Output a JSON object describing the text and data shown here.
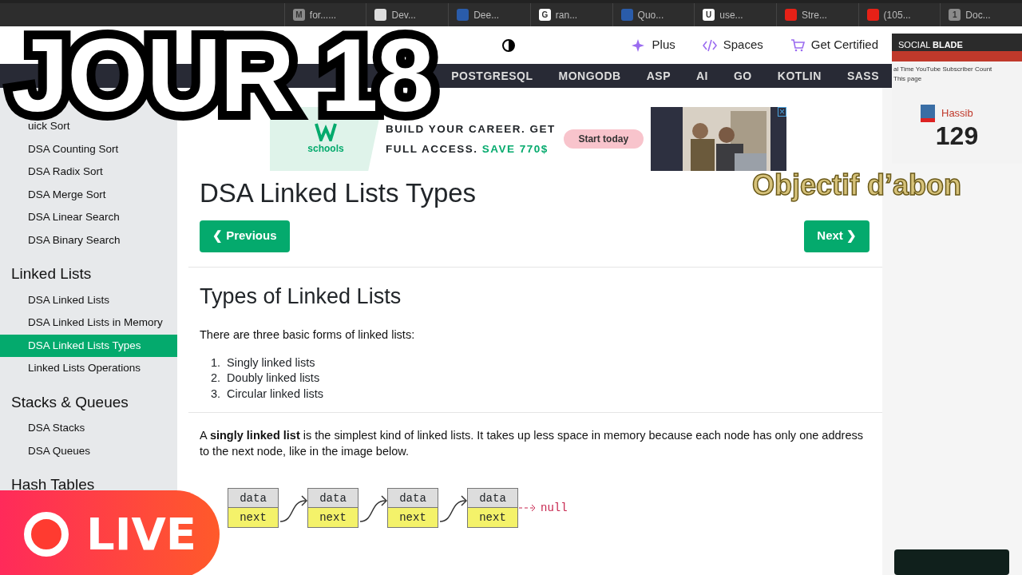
{
  "browser_tabs": [
    {
      "title": "for......",
      "icon": "M",
      "color": "#8a8a8a"
    },
    {
      "title": "Dev...",
      "color": "#dddddd"
    },
    {
      "title": "Dee...",
      "color": "#2a5caa"
    },
    {
      "title": "ran...",
      "icon": "G",
      "color": "#ffffff"
    },
    {
      "title": "Quo...",
      "color": "#2a5caa"
    },
    {
      "title": "use...",
      "icon": "U",
      "color": "#ffffff"
    },
    {
      "title": "Stre...",
      "color": "#e62117"
    },
    {
      "title": "(105...",
      "color": "#e62117"
    },
    {
      "title": "Doc...",
      "icon": "1",
      "color": "#8a8a8a"
    }
  ],
  "header": {
    "links": [
      {
        "label": "Plus",
        "kind": "sparkle"
      },
      {
        "label": "Spaces",
        "kind": "code"
      },
      {
        "label": "Get Certified",
        "kind": "cart"
      }
    ]
  },
  "topnav": {
    "items": [
      "POSTGRESQL",
      "MONGODB",
      "ASP",
      "AI",
      "GO",
      "KOTLIN",
      "SASS"
    ]
  },
  "sidebar": [
    {
      "kind": "item",
      "label": "uick Sort",
      "selected": false
    },
    {
      "kind": "item",
      "label": "DSA Counting Sort",
      "selected": false
    },
    {
      "kind": "item",
      "label": "DSA Radix Sort",
      "selected": false
    },
    {
      "kind": "item",
      "label": "DSA Merge Sort",
      "selected": false
    },
    {
      "kind": "item",
      "label": "DSA Linear Search",
      "selected": false
    },
    {
      "kind": "item",
      "label": "DSA Binary Search",
      "selected": false
    },
    {
      "kind": "heading",
      "label": "Linked Lists"
    },
    {
      "kind": "item",
      "label": "DSA Linked Lists",
      "selected": false
    },
    {
      "kind": "item",
      "label": "DSA Linked Lists in Memory",
      "selected": false
    },
    {
      "kind": "item",
      "label": "DSA Linked Lists Types",
      "selected": true
    },
    {
      "kind": "item",
      "label": "Linked Lists Operations",
      "selected": false
    },
    {
      "kind": "heading",
      "label": "Stacks & Queues"
    },
    {
      "kind": "item",
      "label": "DSA Stacks",
      "selected": false
    },
    {
      "kind": "item",
      "label": "DSA Queues",
      "selected": false
    },
    {
      "kind": "heading",
      "label": "Hash Tables"
    }
  ],
  "ad": {
    "logo": "schools",
    "line1": "BUILD YOUR CAREER. GET",
    "line2": "FULL ACCESS.",
    "highlight": "SAVE 770$",
    "button": "Start today",
    "close": "×"
  },
  "page": {
    "title": "DSA Linked Lists Types",
    "prev": "❮ Previous",
    "next": "Next ❯",
    "heading": "Types of Linked Lists",
    "intro": "There are three basic forms of linked lists:",
    "list": [
      {
        "number": "1.",
        "text": "Singly linked lists"
      },
      {
        "number": "2.",
        "text": "Doubly linked lists"
      },
      {
        "number": "3.",
        "text": "Circular linked lists"
      }
    ],
    "paragraph": "A **singly linked list** is the simplest kind of linked lists. It takes up less space in memory because each node has only one address to the next node, like in the image below.",
    "nodes": [
      {
        "data": "data",
        "next": "next"
      },
      {
        "data": "data",
        "next": "next"
      },
      {
        "data": "data",
        "next": "next"
      },
      {
        "data": "data",
        "next": "next"
      }
    ],
    "null": "null"
  },
  "widget": {
    "brand_light": "SOCIAL",
    "brand_bold": "BLADE",
    "subtitle": "al Time YouTube Subscriber Count",
    "note": "This page",
    "channel": "Hassib",
    "count": "129"
  },
  "overlays": {
    "title": "JOUR 18",
    "goal": "Objectif d’abon",
    "live": "LIVE"
  }
}
